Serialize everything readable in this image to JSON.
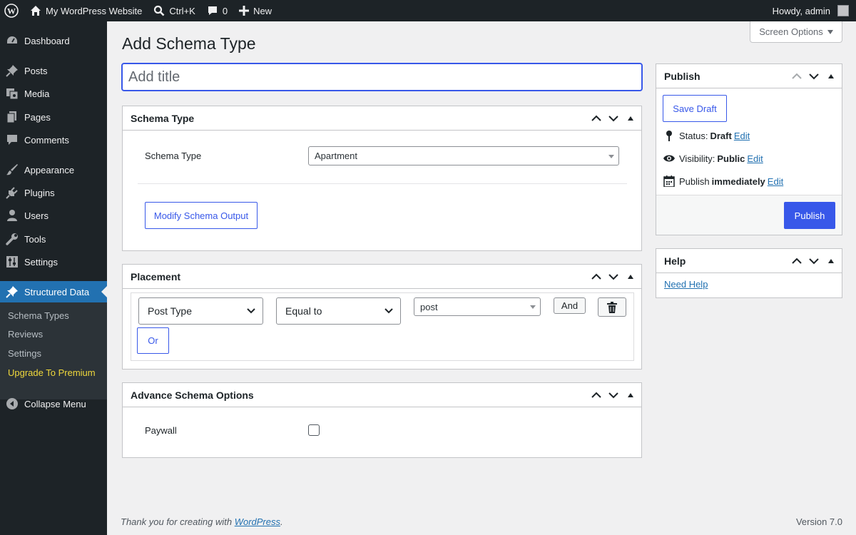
{
  "admin_bar": {
    "site_name": "My WordPress Website",
    "search_shortcut": "Ctrl+K",
    "comment_count": "0",
    "new_label": "New",
    "greeting": "Howdy, admin"
  },
  "sidebar": {
    "items": [
      {
        "label": "Dashboard",
        "icon": "dashboard-icon"
      },
      {
        "label": "Posts",
        "icon": "pin-icon"
      },
      {
        "label": "Media",
        "icon": "media-icon"
      },
      {
        "label": "Pages",
        "icon": "pages-icon"
      },
      {
        "label": "Comments",
        "icon": "comments-icon"
      },
      {
        "label": "Appearance",
        "icon": "brush-icon"
      },
      {
        "label": "Plugins",
        "icon": "plugin-icon"
      },
      {
        "label": "Users",
        "icon": "user-icon"
      },
      {
        "label": "Tools",
        "icon": "wrench-icon"
      },
      {
        "label": "Settings",
        "icon": "settings-icon"
      },
      {
        "label": "Structured Data",
        "icon": "pin-icon"
      }
    ],
    "submenu": [
      "Schema Types",
      "Reviews",
      "Settings",
      "Upgrade To Premium"
    ],
    "collapse_label": "Collapse Menu"
  },
  "screen_options_label": "Screen Options",
  "page_title": "Add Schema Type",
  "title_placeholder": "Add title",
  "schema_box": {
    "title": "Schema Type",
    "field_label": "Schema Type",
    "selected": "Apartment",
    "modify_button": "Modify Schema Output"
  },
  "placement_box": {
    "title": "Placement",
    "param": "Post Type",
    "operator": "Equal to",
    "value": "post",
    "and_button": "And",
    "or_button": "Or"
  },
  "advance_box": {
    "title": "Advance Schema Options",
    "paywall_label": "Paywall",
    "paywall_checked": false
  },
  "publish_box": {
    "title": "Publish",
    "save_draft": "Save Draft",
    "status_label": "Status:",
    "status_value": "Draft",
    "visibility_label": "Visibility:",
    "visibility_value": "Public",
    "publish_label": "Publish",
    "publish_value": "immediately",
    "edit_link": "Edit",
    "publish_button": "Publish"
  },
  "help_box": {
    "title": "Help",
    "link": "Need Help"
  },
  "footer": {
    "thanks_prefix": "Thank you for creating with",
    "wordpress_link": "WordPress",
    "thanks_suffix": ".",
    "version": "Version 7.0"
  },
  "colors": {
    "admin_bar_bg": "#1d2327",
    "accent": "#3858e9",
    "current_menu_bg": "#2271b1",
    "premium_text": "#f0d83c"
  }
}
